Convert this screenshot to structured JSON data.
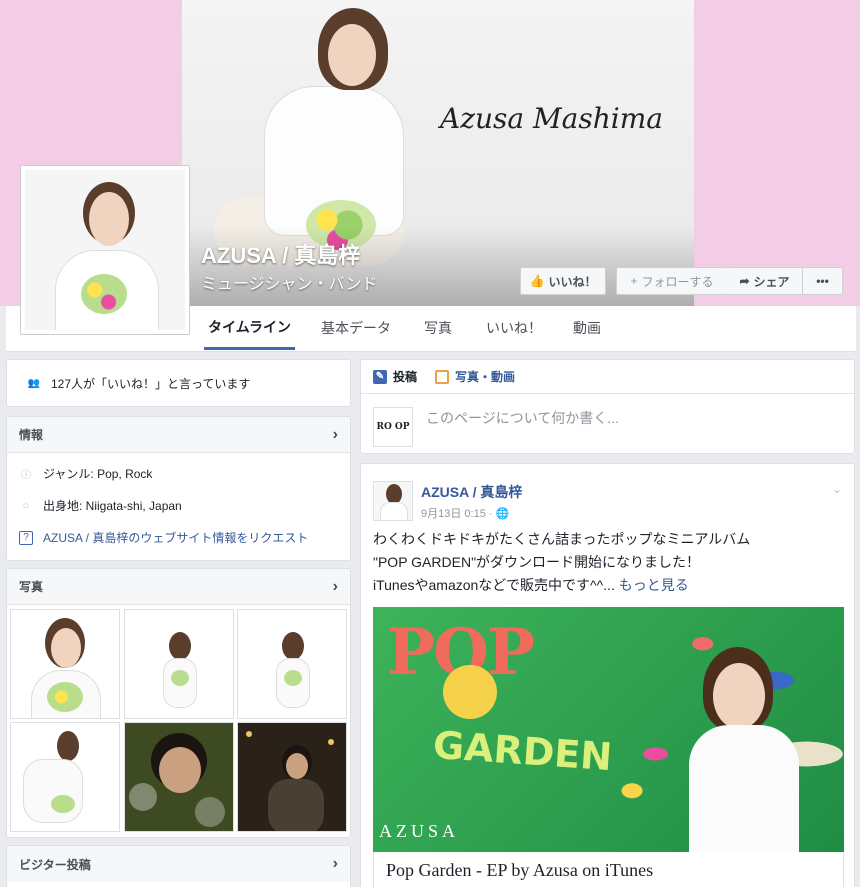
{
  "cover": {
    "signature": "Azusa Mashima"
  },
  "page": {
    "name": "AZUSA / 真島梓",
    "category": "ミュージシャン・バンド"
  },
  "actions": {
    "like": "いいね！",
    "follow": "フォローする",
    "share": "シェア",
    "more": "•••"
  },
  "tabs": [
    "タイムライン",
    "基本データ",
    "写真",
    "いいね！",
    "動画"
  ],
  "likes_card": {
    "text": "127人が「いいね！」と言っています"
  },
  "info": {
    "title": "情報",
    "genre": "ジャンル: Pop, Rock",
    "hometown": "出身地: Niigata-shi, Japan",
    "request": "AZUSA / 真島梓のウェブサイト情報をリクエスト"
  },
  "photos": {
    "title": "写真"
  },
  "visitor_posts": {
    "title": "ビジター投稿"
  },
  "composer": {
    "tab_post": "投稿",
    "tab_photo": "写真・動画",
    "placeholder": "このページについて何か書く...",
    "avatar_text": "RO OP"
  },
  "post": {
    "author": "AZUSA / 真島梓",
    "time": "9月13日 0:15 ·",
    "line1": "わくわくドキドキがたくさん詰まったポップなミニアルバム",
    "line2": "\"POP GARDEN\"がダウンロード開始になりました！",
    "line3": "iTunesやamazonなどで販売中です^^...",
    "see_more": "もっと見る",
    "image_text_pop": "POP",
    "image_text_garden": "GARDEN",
    "image_text_azusa": "AZUSA",
    "link_title": "Pop Garden - EP by Azusa on iTunes"
  },
  "colors": {
    "accent": "#4267b2",
    "cover_pink": "#f3cde6",
    "link": "#365899"
  }
}
